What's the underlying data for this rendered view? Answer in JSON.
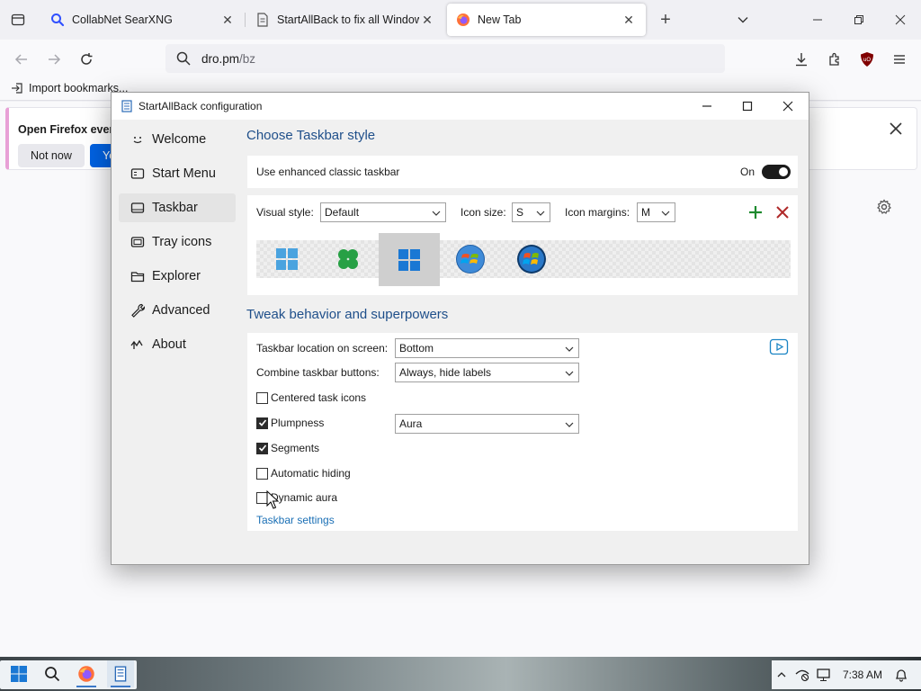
{
  "browser": {
    "tabs": [
      {
        "title": "CollabNet SearXNG",
        "icon": "search-icon"
      },
      {
        "title": "StartAllBack to fix all Windows",
        "icon": "page-icon"
      },
      {
        "title": "New Tab",
        "icon": "firefox-icon",
        "active": true
      }
    ],
    "url": {
      "domain": "dro.pm",
      "path": "/bz"
    },
    "bookmarks": {
      "import_label": "Import bookmarks..."
    },
    "notification": {
      "text": "Open Firefox every",
      "secondary_button": "Not now",
      "primary_button": "Yes"
    }
  },
  "dialog": {
    "title": "StartAllBack configuration",
    "sidebar": [
      {
        "label": "Welcome",
        "icon": "smiley-icon"
      },
      {
        "label": "Start Menu",
        "icon": "start-menu-icon"
      },
      {
        "label": "Taskbar",
        "icon": "taskbar-icon",
        "selected": true
      },
      {
        "label": "Tray icons",
        "icon": "tray-icon"
      },
      {
        "label": "Explorer",
        "icon": "folder-icon"
      },
      {
        "label": "Advanced",
        "icon": "wrench-icon"
      },
      {
        "label": "About",
        "icon": "about-icon"
      }
    ],
    "style_section": {
      "title": "Choose Taskbar style",
      "enhanced_label": "Use enhanced classic taskbar",
      "toggle_state": "On",
      "visual_style_label": "Visual style:",
      "visual_style_value": "Default",
      "icon_size_label": "Icon size:",
      "icon_size_value": "S",
      "icon_margins_label": "Icon margins:",
      "icon_margins_value": "M",
      "styles": [
        {
          "name": "windows-11-style-icon"
        },
        {
          "name": "clover-style-icon"
        },
        {
          "name": "windows-10-style-icon",
          "selected": true
        },
        {
          "name": "windows-7-orb-icon"
        },
        {
          "name": "windows-vista-orb-icon"
        }
      ]
    },
    "tweak_section": {
      "title": "Tweak behavior and superpowers",
      "location_label": "Taskbar location on screen:",
      "location_value": "Bottom",
      "combine_label": "Combine taskbar buttons:",
      "combine_value": "Always, hide labels",
      "centered_label": "Centered task icons",
      "centered_checked": false,
      "plumpness_label": "Plumpness",
      "plumpness_checked": true,
      "plumpness_value": "Aura",
      "segments_label": "Segments",
      "segments_checked": true,
      "autohide_label": "Automatic hiding",
      "autohide_checked": false,
      "dynamic_aura_label": "Dynamic aura",
      "dynamic_aura_checked": false,
      "settings_link": "Taskbar settings"
    }
  },
  "taskbar": {
    "clock": "7:38 AM"
  }
}
